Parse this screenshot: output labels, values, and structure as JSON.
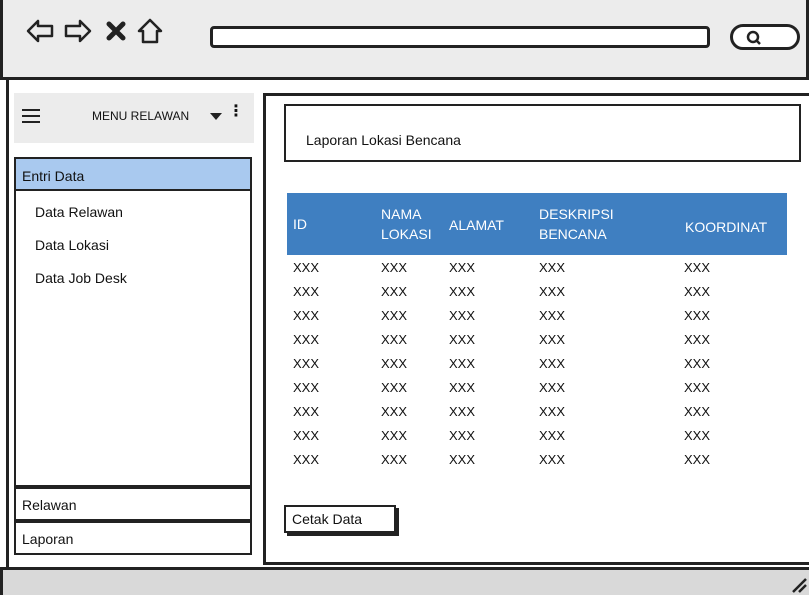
{
  "browser": {
    "nav_icons": [
      "back-arrow-icon",
      "forward-arrow-icon",
      "close-icon",
      "home-icon"
    ],
    "search_icon": "search-icon"
  },
  "sidebar": {
    "menu_title": "MENU RELAWAN",
    "active_item": "Entri Data",
    "sub_items": [
      "Data Relawan",
      "Data Lokasi",
      "Data Job Desk"
    ],
    "footer_items": [
      "Relawan",
      "Laporan"
    ]
  },
  "main": {
    "title": "Laporan Lokasi Bencana",
    "table": {
      "headers": [
        {
          "line1": "ID",
          "line2": ""
        },
        {
          "line1": "NAMA",
          "line2": "LOKASI"
        },
        {
          "line1": "ALAMAT",
          "line2": ""
        },
        {
          "line1": "DESKRIPSI",
          "line2": "BENCANA"
        },
        {
          "line1": "KOORDINAT",
          "line2": ""
        }
      ],
      "rows": [
        [
          "XXX",
          "XXX",
          "XXX",
          "XXX",
          "XXX"
        ],
        [
          "XXX",
          "XXX",
          "XXX",
          "XXX",
          "XXX"
        ],
        [
          "XXX",
          "XXX",
          "XXX",
          "XXX",
          "XXX"
        ],
        [
          "XXX",
          "XXX",
          "XXX",
          "XXX",
          "XXX"
        ],
        [
          "XXX",
          "XXX",
          "XXX",
          "XXX",
          "XXX"
        ],
        [
          "XXX",
          "XXX",
          "XXX",
          "XXX",
          "XXX"
        ],
        [
          "XXX",
          "XXX",
          "XXX",
          "XXX",
          "XXX"
        ],
        [
          "XXX",
          "XXX",
          "XXX",
          "XXX",
          "XXX"
        ],
        [
          "XXX",
          "XXX",
          "XXX",
          "XXX",
          "XXX"
        ]
      ]
    },
    "print_button": "Cetak Data"
  },
  "colors": {
    "table_header": "#3f7fc1",
    "active_menu": "#a9c9ef",
    "toolbar": "#ececec"
  }
}
